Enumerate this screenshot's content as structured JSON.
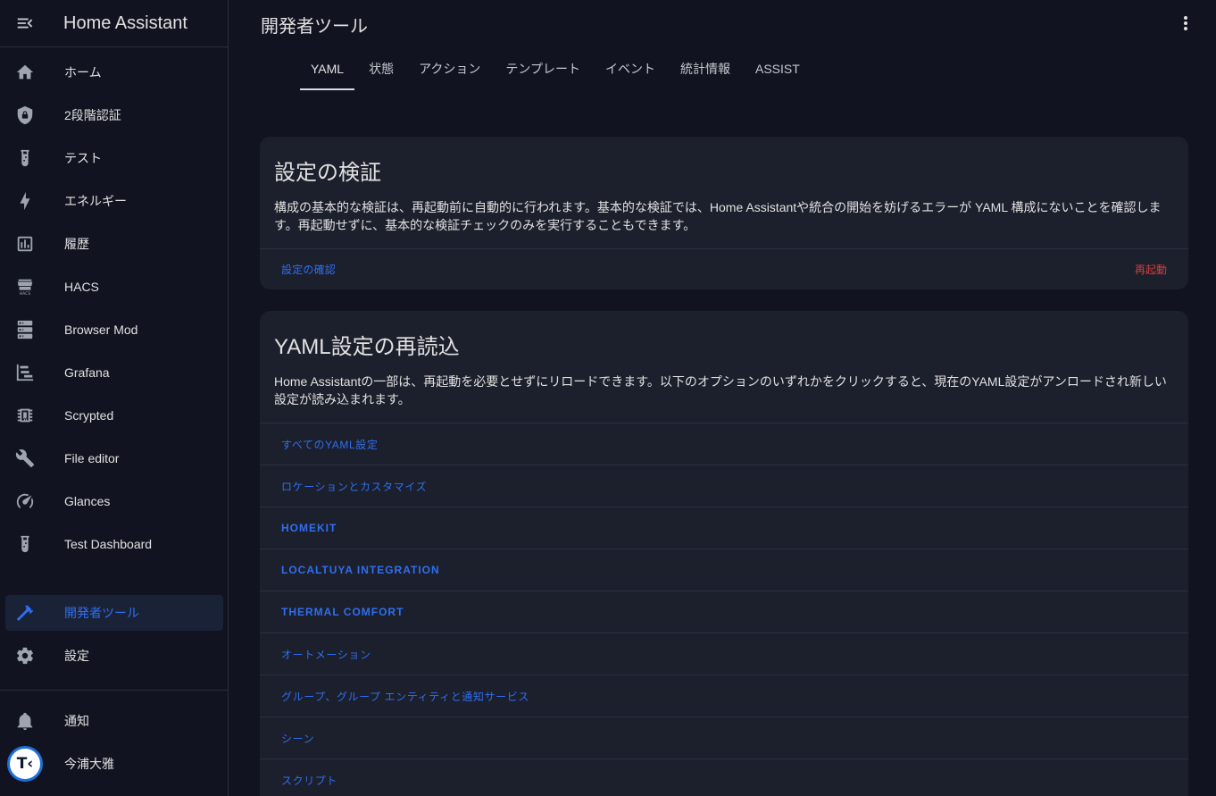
{
  "app": {
    "title": "Home Assistant"
  },
  "sidebar": {
    "items": [
      {
        "label": "ホーム",
        "icon": "home-icon"
      },
      {
        "label": "2段階認証",
        "icon": "shield-lock-icon"
      },
      {
        "label": "テスト",
        "icon": "test-tube-icon"
      },
      {
        "label": "エネルギー",
        "icon": "lightning-bolt-icon"
      },
      {
        "label": "履歴",
        "icon": "chart-box-icon"
      },
      {
        "label": "HACS",
        "icon": "hacs-store-icon"
      },
      {
        "label": "Browser Mod",
        "icon": "server-icon"
      },
      {
        "label": "Grafana",
        "icon": "chart-gantt-icon"
      },
      {
        "label": "Scrypted",
        "icon": "chip-icon"
      },
      {
        "label": "File editor",
        "icon": "wrench-icon"
      },
      {
        "label": "Glances",
        "icon": "gauge-icon"
      },
      {
        "label": "Test Dashboard",
        "icon": "test-tube-icon"
      }
    ],
    "developer_tools": "開発者ツール",
    "settings": "設定",
    "notifications": "通知",
    "user": "今浦大雅",
    "avatar_text": "T‹"
  },
  "header": {
    "title": "開発者ツール"
  },
  "tabs": [
    "YAML",
    "状態",
    "アクション",
    "テンプレート",
    "イベント",
    "統計情報",
    "ASSIST"
  ],
  "config_check": {
    "title": "設定の検証",
    "description": "構成の基本的な検証は、再起動前に自動的に行われます。基本的な検証では、Home Assistantや統合の開始を妨げるエラーが YAML 構成にないことを確認します。再起動せずに、基本的な検証チェックのみを実行することもできます。",
    "check_button": "設定の確認",
    "restart_button": "再起動"
  },
  "yaml_reload": {
    "title": "YAML設定の再読込",
    "description": "Home Assistantの一部は、再起動を必要とせずにリロードできます。以下のオプションのいずれかをクリックすると、現在のYAML設定がアンロードされ新しい設定が読み込まれます。",
    "items": [
      "すべてのYAML設定",
      "ロケーションとカスタマイズ",
      "HOMEKIT",
      "LOCALTUYA INTEGRATION",
      "THERMAL COMFORT",
      "オートメーション",
      "グループ、グループ エンティティと通知サービス",
      " シーン",
      "スクリプト"
    ]
  },
  "colors": {
    "accent": "#2f6ff0",
    "danger": "#d4403a",
    "background": "#111420",
    "card": "#1c1f2c"
  }
}
